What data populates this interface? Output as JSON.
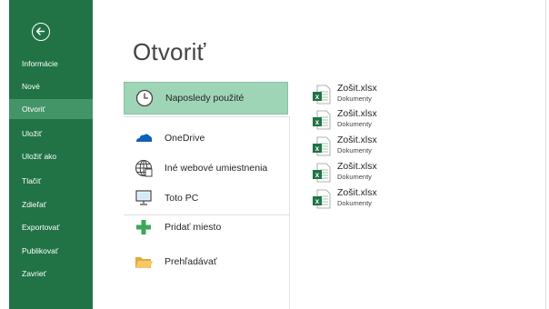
{
  "sidebar": {
    "back": "back-arrow",
    "items": [
      {
        "label": "Informácie"
      },
      {
        "label": "Nové"
      },
      {
        "label": "Otvoriť"
      },
      {
        "label": "Uložiť"
      },
      {
        "label": "Uložiť ako"
      },
      {
        "label": "Tlačiť"
      },
      {
        "label": "Zdieľať"
      },
      {
        "label": "Exportovať"
      },
      {
        "label": "Publikovať"
      },
      {
        "label": "Zavrieť"
      }
    ],
    "active_index": 2,
    "colors": {
      "bg": "#217346",
      "active": "#439467"
    }
  },
  "main": {
    "title": "Otvoriť",
    "locations": [
      {
        "label": "Naposledy použité",
        "icon": "clock-icon",
        "selected": true
      },
      {
        "label": "OneDrive",
        "icon": "cloud-icon"
      },
      {
        "label": "Iné webové umiestnenia",
        "icon": "globe-icon"
      },
      {
        "label": "Toto PC",
        "icon": "computer-icon"
      },
      {
        "label": "Pridať miesto",
        "icon": "plus-icon"
      },
      {
        "label": "Prehľadávať",
        "icon": "folder-icon"
      }
    ],
    "files": [
      {
        "name": "Zošit.xlsx",
        "path": "Dokumenty"
      },
      {
        "name": "Zošit.xlsx",
        "path": "Dokumenty"
      },
      {
        "name": "Zošit.xlsx",
        "path": "Dokumenty"
      },
      {
        "name": "Zošit.xlsx",
        "path": "Dokumenty"
      },
      {
        "name": "Zošit.xlsx",
        "path": "Dokumenty"
      }
    ],
    "colors": {
      "selected": "#9fd5b7",
      "excel": "#217346"
    }
  }
}
